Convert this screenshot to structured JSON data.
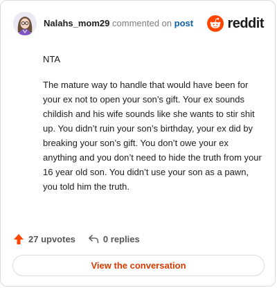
{
  "header": {
    "username": "Nalahs_mom29",
    "action_text": "commented on",
    "post_link": "post",
    "brand_name": "reddit"
  },
  "comment": {
    "paragraphs": [
      "NTA",
      "The mature way to handle that would have been for your ex not to open your son’s gift. Your ex sounds childish and his wife sounds like she wants to stir shit up. You didn’t ruin your son’s birthday, your ex did by breaking your son’s gift. You don’t owe your ex anything and you don’t need to hide the truth from your 16 year old son. You didn’t use your son as a pawn, you told him the truth."
    ]
  },
  "actions": {
    "upvotes_label": "27 upvotes",
    "replies_label": "0 replies"
  },
  "cta": {
    "label": "View the conversation"
  },
  "colors": {
    "brand_orange": "#ff4500",
    "upvote_orange": "#ff4500",
    "link_blue": "#0b5fa8",
    "cta_text": "#d93900"
  },
  "icons": {
    "avatar": "user-avatar",
    "brand": "reddit-snoo-icon",
    "upvote": "upvote-arrow-icon",
    "reply": "reply-arrow-icon"
  }
}
